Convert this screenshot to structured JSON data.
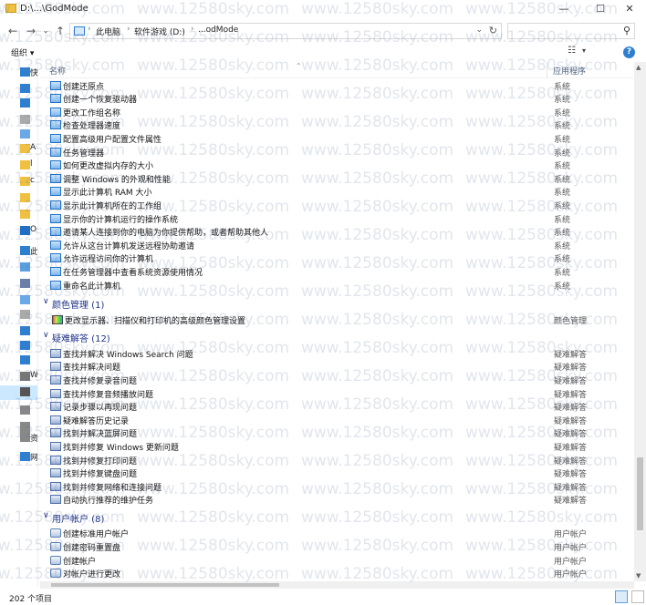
{
  "window": {
    "title": "D:\\...\\GodMode",
    "minimize": "—",
    "maximize": "☐",
    "close": "✕"
  },
  "nav": {
    "back": "←",
    "forward": "→",
    "dropdown": "⌄",
    "up": "↑",
    "breadcrumbs": [
      "此电脑",
      "软件游戏 (D:)",
      "...odMode"
    ],
    "address_dropdown": "⌄",
    "refresh": "↻",
    "search_placeholder": "",
    "search_icon": "⚲"
  },
  "toolbar": {
    "organize": "组织 ▾",
    "view_details": "☷",
    "view_dropdown": "▾",
    "help": "?"
  },
  "navpane": {
    "items": [
      {
        "label": "快",
        "icon": "star-icon"
      },
      {
        "label": "",
        "icon": "desktop-icon"
      },
      {
        "label": "",
        "icon": "download-icon"
      },
      {
        "label": "",
        "icon": "documents-icon"
      },
      {
        "label": "",
        "icon": "pictures-icon"
      },
      {
        "label": "A",
        "icon": "folder-icon"
      },
      {
        "label": "l",
        "icon": "folder-icon"
      },
      {
        "label": "c",
        "icon": "folder-icon"
      },
      {
        "label": "",
        "icon": "folder-icon"
      },
      {
        "label": "",
        "icon": "folder-icon"
      },
      {
        "label": "O",
        "icon": "onedrive-icon"
      },
      {
        "label": "此",
        "icon": "pc-icon"
      },
      {
        "label": "",
        "icon": "3d-objects-icon"
      },
      {
        "label": "",
        "icon": "video-icon"
      },
      {
        "label": "",
        "icon": "pictures-icon"
      },
      {
        "label": "",
        "icon": "documents-icon"
      },
      {
        "label": "",
        "icon": "download-icon"
      },
      {
        "label": "",
        "icon": "music-icon"
      },
      {
        "label": "",
        "icon": "desktop-icon"
      },
      {
        "label": "W",
        "icon": "drive-c-icon"
      },
      {
        "label": "",
        "icon": "drive-d-icon"
      },
      {
        "label": "",
        "icon": "drive-icon"
      },
      {
        "label": "",
        "icon": "drive-icon"
      },
      {
        "label": "",
        "icon": "drive-icon"
      },
      {
        "label": "资",
        "icon": "drive-icon"
      },
      {
        "label": "网",
        "icon": "network-icon"
      }
    ]
  },
  "columns": {
    "name": "名称",
    "category": "应用程序"
  },
  "top_rows": [
    {
      "label": "创建还原点",
      "cat": "系统"
    },
    {
      "label": "创建一个恢复驱动器",
      "cat": "系统"
    },
    {
      "label": "更改工作组名称",
      "cat": "系统"
    },
    {
      "label": "检查处理器速度",
      "cat": "系统"
    },
    {
      "label": "配置高级用户配置文件属性",
      "cat": "系统"
    },
    {
      "label": "任务管理器",
      "cat": "系统"
    },
    {
      "label": "如何更改虚拟内存的大小",
      "cat": "系统"
    },
    {
      "label": "调整 Windows 的外观和性能",
      "cat": "系统"
    },
    {
      "label": "显示此计算机 RAM 大小",
      "cat": "系统"
    },
    {
      "label": "显示此计算机所在的工作组",
      "cat": "系统"
    },
    {
      "label": "显示你的计算机运行的操作系统",
      "cat": "系统"
    },
    {
      "label": "邀请某人连接到你的电脑为你提供帮助，或者帮助其他人",
      "cat": "系统"
    },
    {
      "label": "允许从这台计算机发送远程协助邀请",
      "cat": "系统"
    },
    {
      "label": "允许远程访问你的计算机",
      "cat": "系统"
    },
    {
      "label": "在任务管理器中查看系统资源使用情况",
      "cat": "系统"
    },
    {
      "label": "重命名此计算机",
      "cat": "系统"
    }
  ],
  "groups": [
    {
      "title": "颜色管理 (1)",
      "rows": [
        {
          "label": "更改显示器、扫描仪和打印机的高级颜色管理设置",
          "cat": "颜色管理"
        }
      ]
    },
    {
      "title": "疑难解答 (12)",
      "rows": [
        {
          "label": "查找并解决 Windows Search 问题",
          "cat": "疑难解答"
        },
        {
          "label": "查找并解决问题",
          "cat": "疑难解答"
        },
        {
          "label": "查找并修复录音问题",
          "cat": "疑难解答"
        },
        {
          "label": "查找并修复音频播放问题",
          "cat": "疑难解答"
        },
        {
          "label": "记录步骤以再现问题",
          "cat": "疑难解答"
        },
        {
          "label": "疑难解答历史记录",
          "cat": "疑难解答"
        },
        {
          "label": "找到并解决蓝屏问题",
          "cat": "疑难解答"
        },
        {
          "label": "找到并修复 Windows 更新问题",
          "cat": "疑难解答"
        },
        {
          "label": "找到并修复打印问题",
          "cat": "疑难解答"
        },
        {
          "label": "找到并修复键盘问题",
          "cat": "疑难解答"
        },
        {
          "label": "找到并修复网络和连接问题",
          "cat": "疑难解答"
        },
        {
          "label": "自动执行推荐的维护任务",
          "cat": "疑难解答"
        }
      ]
    },
    {
      "title": "用户帐户 (8)",
      "rows": [
        {
          "label": "创建标准用户帐户",
          "cat": "用户帐户"
        },
        {
          "label": "创建密码重置盘",
          "cat": "用户帐户"
        },
        {
          "label": "创建帐户",
          "cat": "用户帐户"
        },
        {
          "label": "对帐户进行更改",
          "cat": "用户帐户"
        }
      ]
    }
  ],
  "status": {
    "count": "202 个项目"
  },
  "watermark": "www.12580sky.com"
}
